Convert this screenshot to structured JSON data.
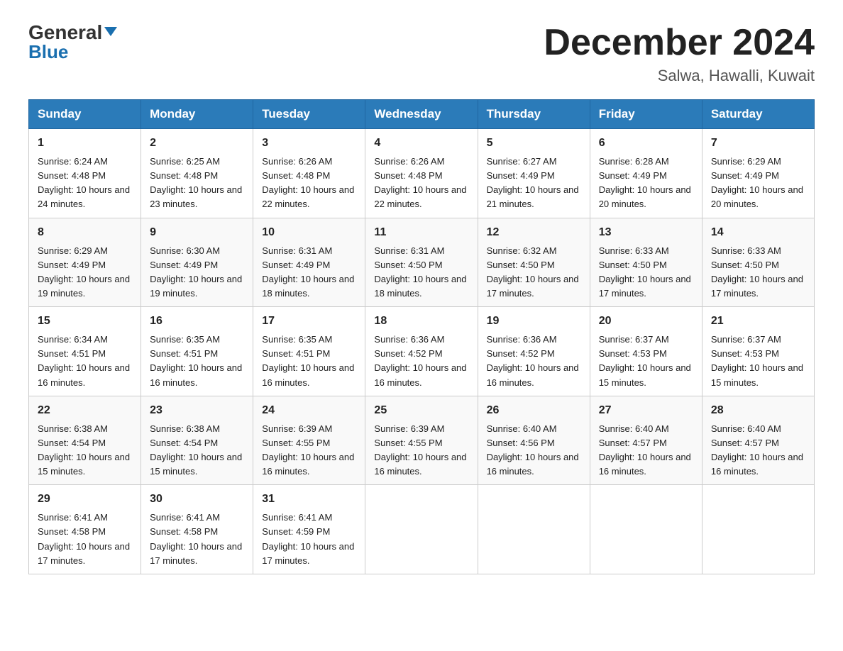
{
  "header": {
    "logo_line1_general": "General",
    "logo_line1_blue": "Blue",
    "month_title": "December 2024",
    "location": "Salwa, Hawalli, Kuwait"
  },
  "weekdays": [
    "Sunday",
    "Monday",
    "Tuesday",
    "Wednesday",
    "Thursday",
    "Friday",
    "Saturday"
  ],
  "weeks": [
    [
      {
        "day": "1",
        "sunrise": "Sunrise: 6:24 AM",
        "sunset": "Sunset: 4:48 PM",
        "daylight": "Daylight: 10 hours and 24 minutes."
      },
      {
        "day": "2",
        "sunrise": "Sunrise: 6:25 AM",
        "sunset": "Sunset: 4:48 PM",
        "daylight": "Daylight: 10 hours and 23 minutes."
      },
      {
        "day": "3",
        "sunrise": "Sunrise: 6:26 AM",
        "sunset": "Sunset: 4:48 PM",
        "daylight": "Daylight: 10 hours and 22 minutes."
      },
      {
        "day": "4",
        "sunrise": "Sunrise: 6:26 AM",
        "sunset": "Sunset: 4:48 PM",
        "daylight": "Daylight: 10 hours and 22 minutes."
      },
      {
        "day": "5",
        "sunrise": "Sunrise: 6:27 AM",
        "sunset": "Sunset: 4:49 PM",
        "daylight": "Daylight: 10 hours and 21 minutes."
      },
      {
        "day": "6",
        "sunrise": "Sunrise: 6:28 AM",
        "sunset": "Sunset: 4:49 PM",
        "daylight": "Daylight: 10 hours and 20 minutes."
      },
      {
        "day": "7",
        "sunrise": "Sunrise: 6:29 AM",
        "sunset": "Sunset: 4:49 PM",
        "daylight": "Daylight: 10 hours and 20 minutes."
      }
    ],
    [
      {
        "day": "8",
        "sunrise": "Sunrise: 6:29 AM",
        "sunset": "Sunset: 4:49 PM",
        "daylight": "Daylight: 10 hours and 19 minutes."
      },
      {
        "day": "9",
        "sunrise": "Sunrise: 6:30 AM",
        "sunset": "Sunset: 4:49 PM",
        "daylight": "Daylight: 10 hours and 19 minutes."
      },
      {
        "day": "10",
        "sunrise": "Sunrise: 6:31 AM",
        "sunset": "Sunset: 4:49 PM",
        "daylight": "Daylight: 10 hours and 18 minutes."
      },
      {
        "day": "11",
        "sunrise": "Sunrise: 6:31 AM",
        "sunset": "Sunset: 4:50 PM",
        "daylight": "Daylight: 10 hours and 18 minutes."
      },
      {
        "day": "12",
        "sunrise": "Sunrise: 6:32 AM",
        "sunset": "Sunset: 4:50 PM",
        "daylight": "Daylight: 10 hours and 17 minutes."
      },
      {
        "day": "13",
        "sunrise": "Sunrise: 6:33 AM",
        "sunset": "Sunset: 4:50 PM",
        "daylight": "Daylight: 10 hours and 17 minutes."
      },
      {
        "day": "14",
        "sunrise": "Sunrise: 6:33 AM",
        "sunset": "Sunset: 4:50 PM",
        "daylight": "Daylight: 10 hours and 17 minutes."
      }
    ],
    [
      {
        "day": "15",
        "sunrise": "Sunrise: 6:34 AM",
        "sunset": "Sunset: 4:51 PM",
        "daylight": "Daylight: 10 hours and 16 minutes."
      },
      {
        "day": "16",
        "sunrise": "Sunrise: 6:35 AM",
        "sunset": "Sunset: 4:51 PM",
        "daylight": "Daylight: 10 hours and 16 minutes."
      },
      {
        "day": "17",
        "sunrise": "Sunrise: 6:35 AM",
        "sunset": "Sunset: 4:51 PM",
        "daylight": "Daylight: 10 hours and 16 minutes."
      },
      {
        "day": "18",
        "sunrise": "Sunrise: 6:36 AM",
        "sunset": "Sunset: 4:52 PM",
        "daylight": "Daylight: 10 hours and 16 minutes."
      },
      {
        "day": "19",
        "sunrise": "Sunrise: 6:36 AM",
        "sunset": "Sunset: 4:52 PM",
        "daylight": "Daylight: 10 hours and 16 minutes."
      },
      {
        "day": "20",
        "sunrise": "Sunrise: 6:37 AM",
        "sunset": "Sunset: 4:53 PM",
        "daylight": "Daylight: 10 hours and 15 minutes."
      },
      {
        "day": "21",
        "sunrise": "Sunrise: 6:37 AM",
        "sunset": "Sunset: 4:53 PM",
        "daylight": "Daylight: 10 hours and 15 minutes."
      }
    ],
    [
      {
        "day": "22",
        "sunrise": "Sunrise: 6:38 AM",
        "sunset": "Sunset: 4:54 PM",
        "daylight": "Daylight: 10 hours and 15 minutes."
      },
      {
        "day": "23",
        "sunrise": "Sunrise: 6:38 AM",
        "sunset": "Sunset: 4:54 PM",
        "daylight": "Daylight: 10 hours and 15 minutes."
      },
      {
        "day": "24",
        "sunrise": "Sunrise: 6:39 AM",
        "sunset": "Sunset: 4:55 PM",
        "daylight": "Daylight: 10 hours and 16 minutes."
      },
      {
        "day": "25",
        "sunrise": "Sunrise: 6:39 AM",
        "sunset": "Sunset: 4:55 PM",
        "daylight": "Daylight: 10 hours and 16 minutes."
      },
      {
        "day": "26",
        "sunrise": "Sunrise: 6:40 AM",
        "sunset": "Sunset: 4:56 PM",
        "daylight": "Daylight: 10 hours and 16 minutes."
      },
      {
        "day": "27",
        "sunrise": "Sunrise: 6:40 AM",
        "sunset": "Sunset: 4:57 PM",
        "daylight": "Daylight: 10 hours and 16 minutes."
      },
      {
        "day": "28",
        "sunrise": "Sunrise: 6:40 AM",
        "sunset": "Sunset: 4:57 PM",
        "daylight": "Daylight: 10 hours and 16 minutes."
      }
    ],
    [
      {
        "day": "29",
        "sunrise": "Sunrise: 6:41 AM",
        "sunset": "Sunset: 4:58 PM",
        "daylight": "Daylight: 10 hours and 17 minutes."
      },
      {
        "day": "30",
        "sunrise": "Sunrise: 6:41 AM",
        "sunset": "Sunset: 4:58 PM",
        "daylight": "Daylight: 10 hours and 17 minutes."
      },
      {
        "day": "31",
        "sunrise": "Sunrise: 6:41 AM",
        "sunset": "Sunset: 4:59 PM",
        "daylight": "Daylight: 10 hours and 17 minutes."
      },
      null,
      null,
      null,
      null
    ]
  ]
}
